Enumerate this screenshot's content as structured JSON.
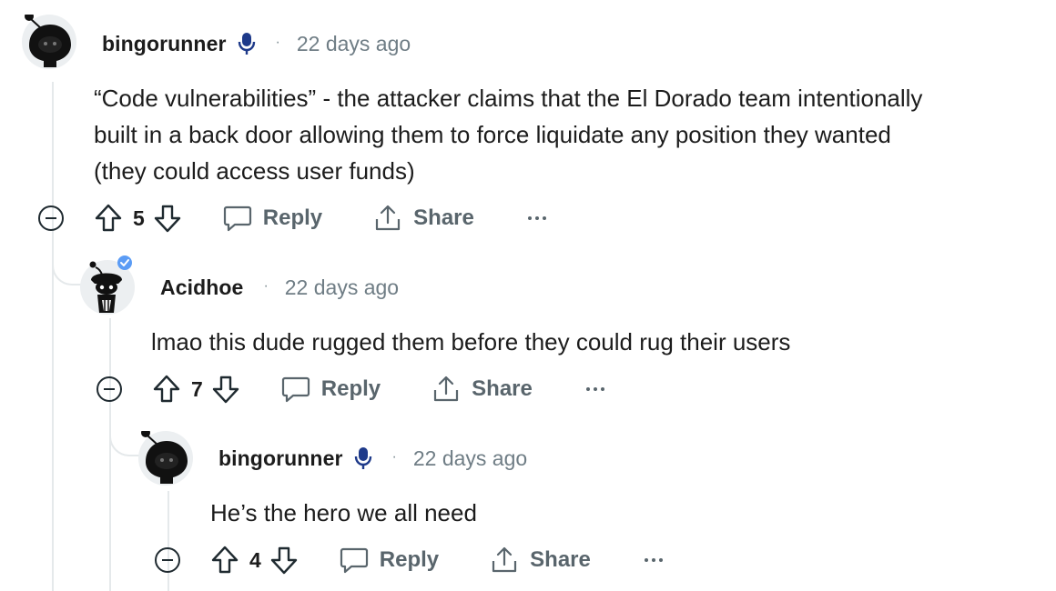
{
  "comments": [
    {
      "username": "bingorunner",
      "has_mic_badge": true,
      "separator": "·",
      "timestamp": "22 days ago",
      "body_lines": [
        "“Code vulnerabilities” - the attacker claims that the El Dorado team intentionally",
        "built in a back door allowing them to force liquidate any position they wanted",
        "(they could access user funds)"
      ],
      "score": "5",
      "reply_label": "Reply",
      "share_label": "Share"
    },
    {
      "username": "Acidhoe",
      "has_verified_badge": true,
      "separator": "·",
      "timestamp": "22 days ago",
      "body_lines": [
        "lmao this dude rugged them before they could rug their users"
      ],
      "score": "7",
      "reply_label": "Reply",
      "share_label": "Share"
    },
    {
      "username": "bingorunner",
      "has_mic_badge": true,
      "separator": "·",
      "timestamp": "22 days ago",
      "body_lines": [
        "He’s the hero we all need"
      ],
      "score": "4",
      "reply_label": "Reply",
      "share_label": "Share"
    }
  ],
  "icons": {
    "upvote": "upvote-arrow-icon",
    "downvote": "downvote-arrow-icon",
    "reply": "speech-bubble-icon",
    "share": "share-upload-icon",
    "more": "ellipsis-icon",
    "collapse": "minus-circle-icon",
    "badge_mic": "microphone-icon",
    "badge_verified": "verified-check-icon"
  },
  "colors": {
    "text": "#1c1c1c",
    "meta": "#6f7d85",
    "action": "#59656c",
    "thread_line": "#e5e9eb",
    "mic_badge": "#1e3a8a",
    "verified_badge": "#5b9cf5"
  }
}
